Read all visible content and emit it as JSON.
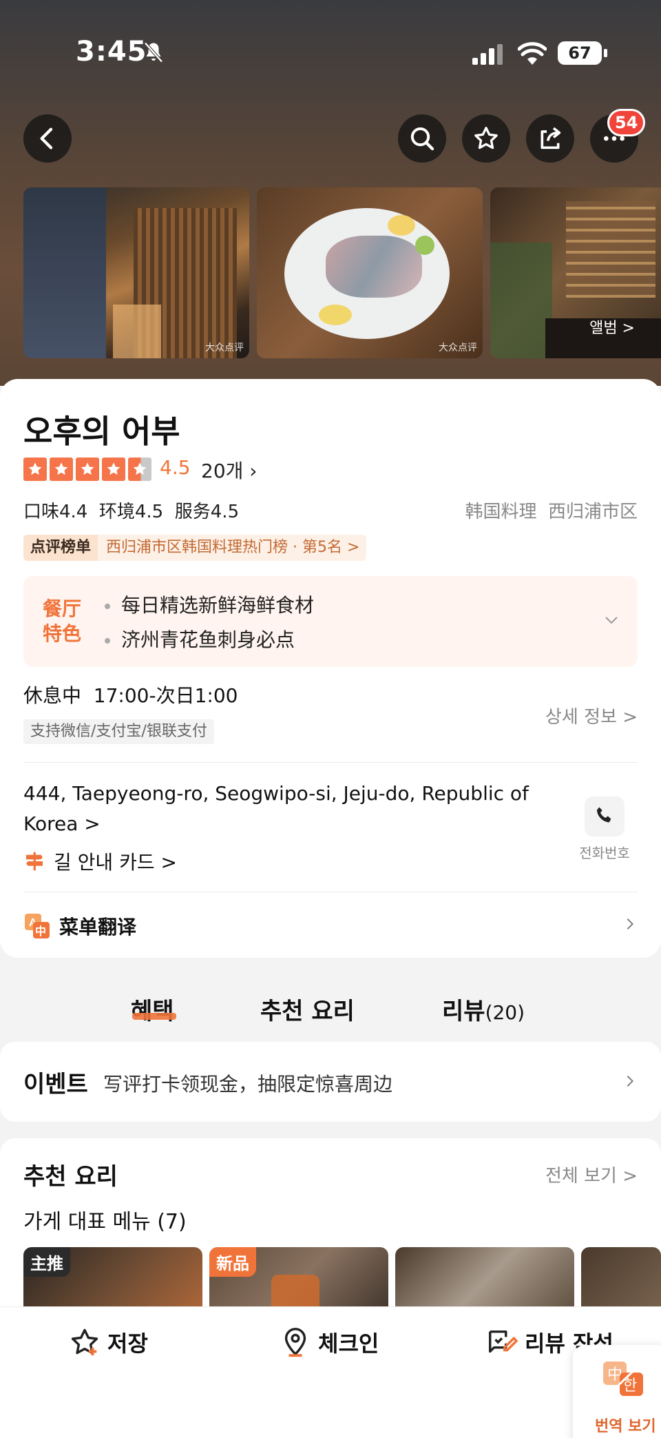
{
  "status": {
    "time": "3:45",
    "battery": "67"
  },
  "header": {
    "more_badge": "54"
  },
  "photos": {
    "watermark": "大众点评",
    "album_label": "앨범 >"
  },
  "restaurant": {
    "name": "오후의 어부",
    "rating": "4.5",
    "rating_value": 4.5,
    "review_count": "20개",
    "subscores": "口味4.4  环境4.5  服务4.5",
    "cuisine": "韩国料理  西归浦市区",
    "rank_tag": "点评榜单",
    "rank_text": "西归浦市区韩国料理热门榜 · 第5名 >",
    "feature_label": "餐厅特色",
    "features": [
      "每日精选新鲜海鲜食材",
      "济州青花鱼刺身必点"
    ],
    "hours": "休息中  17:00-次日1:00",
    "payment": "支持微信/支付宝/银联支付",
    "detail_link": "상세 정보 >",
    "address": "444, Taepyeong-ro, Seogwipo-si, Jeju-do, Republic of Korea >",
    "phone_label": "전화번호",
    "route_label": "길 안내 카드 >",
    "menu_translate": "菜单翻译"
  },
  "tabs": [
    {
      "label": "혜택"
    },
    {
      "label": "추천 요리"
    },
    {
      "label": "리뷰",
      "count": "(20)"
    }
  ],
  "event": {
    "title": "이벤트",
    "text": "写评打卡领现金，抽限定惊喜周边"
  },
  "recommend": {
    "title": "추천 요리",
    "view_all": "전체 보기 >",
    "subtitle": "가게 대표 메뉴 (7)",
    "tags": [
      "主推",
      "新品"
    ]
  },
  "bottom_bar": {
    "save": "저장",
    "checkin": "체크인",
    "write_review": "리뷰 작성"
  },
  "translate_fab": {
    "label": "번역 보기"
  },
  "colors": {
    "accent": "#f0743a",
    "star": "#f5744a",
    "badge": "#f0443a"
  }
}
